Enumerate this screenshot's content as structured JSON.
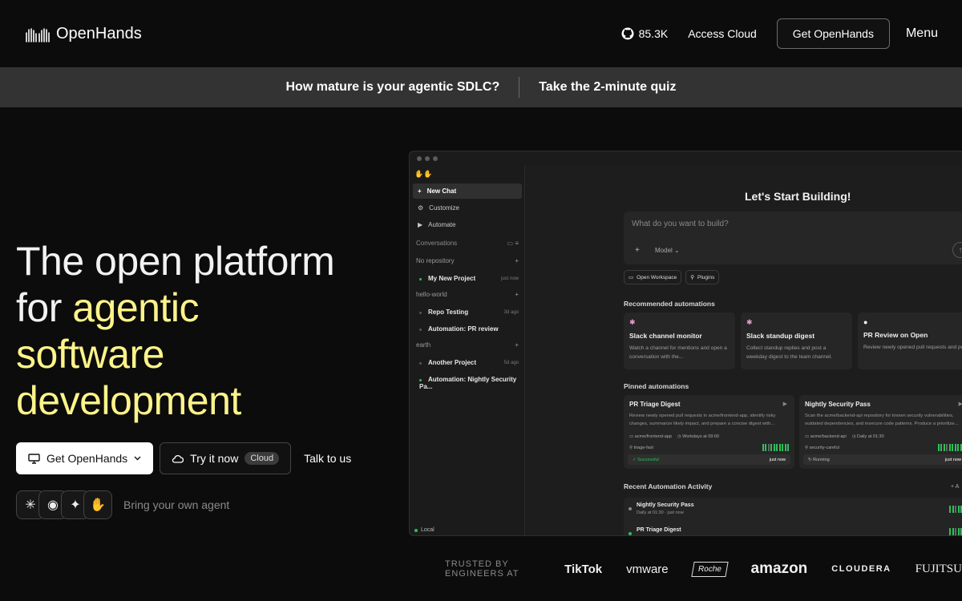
{
  "nav": {
    "brand": "OpenHands",
    "github_stars": "85.3K",
    "access_cloud": "Access Cloud",
    "get_button": "Get OpenHands",
    "menu": "Menu"
  },
  "banner": {
    "question": "How mature is your agentic SDLC?",
    "quiz": "Take the 2-minute quiz"
  },
  "hero": {
    "line1": "The open platform",
    "line2_plain": "for ",
    "line2_hl": "agentic",
    "line3_hl": "software",
    "line4_hl": "development",
    "highlight_color": "#fdf38a",
    "cta_get": "Get OpenHands",
    "cta_try": "Try it now",
    "cta_try_badge": "Cloud",
    "cta_talk": "Talk to us",
    "agents_text": "Bring your own agent"
  },
  "trusted": {
    "label": "TRUSTED BY ENGINEERS AT",
    "brands": [
      "TikTok",
      "vmware",
      "Roche",
      "amazon",
      "CLOUDERA",
      "FUJITSU"
    ]
  },
  "app": {
    "sidebar": {
      "new_chat": "New Chat",
      "customize": "Customize",
      "automate": "Automate",
      "conversations": "Conversations",
      "groups": [
        {
          "name": "No repository",
          "projects": [
            {
              "name": "My New Project",
              "time": "just now"
            }
          ]
        },
        {
          "name": "hello-world",
          "projects": [
            {
              "name": "Repo Testing",
              "time": "3d ago"
            },
            {
              "name": "Automation: PR review",
              "time": ""
            }
          ]
        },
        {
          "name": "earth",
          "projects": [
            {
              "name": "Another Project",
              "time": "5d ago"
            },
            {
              "name": "Automation: Nightly Security Pa...",
              "time": ""
            }
          ]
        }
      ],
      "local": "Local"
    },
    "main": {
      "title": "Let's Start Building!",
      "prompt_placeholder": "What do you want to build?",
      "model": "Model",
      "chip_workspace": "Open Workspace",
      "chip_plugins": "Plugins",
      "recommended_title": "Recommended automations",
      "recommended": [
        {
          "title": "Slack channel monitor",
          "desc": "Watch a channel for mentions and open a conversation with the..."
        },
        {
          "title": "Slack standup digest",
          "desc": "Collect standup replies and post a weekday digest to the team channel."
        },
        {
          "title": "PR Review on Open",
          "desc": "Review newly opened pull requests and post findings as inline comments"
        }
      ],
      "pinned_title": "Pinned automations",
      "pinned": [
        {
          "title": "PR Triage Digest",
          "desc": "Review newly opened pull requests in acme/frontend-app, identify risky changes, summarize likely impact, and prepare a concise digest with...",
          "repo": "acme/frontend-app",
          "schedule": "Workdays at 09:00",
          "tag": "triage-fast",
          "status": "Successful",
          "time": "just now"
        },
        {
          "title": "Nightly Security Pass",
          "desc": "Scan the acme/backend-api repository for known security vulnerabilities, outdated dependencies, and insecure code patterns. Produce a prioritize...",
          "repo": "acme/backend-api",
          "schedule": "Daily at 01:30",
          "tag": "security-careful",
          "status": "Running",
          "time": "just now"
        }
      ],
      "recent_title": "Recent Automation Activity",
      "recent_add": "+ A",
      "recent": [
        {
          "title": "Nightly Security Pass",
          "sub": "Daily at 01:30 · just now"
        },
        {
          "title": "PR Triage Digest",
          "sub": ""
        }
      ]
    }
  }
}
